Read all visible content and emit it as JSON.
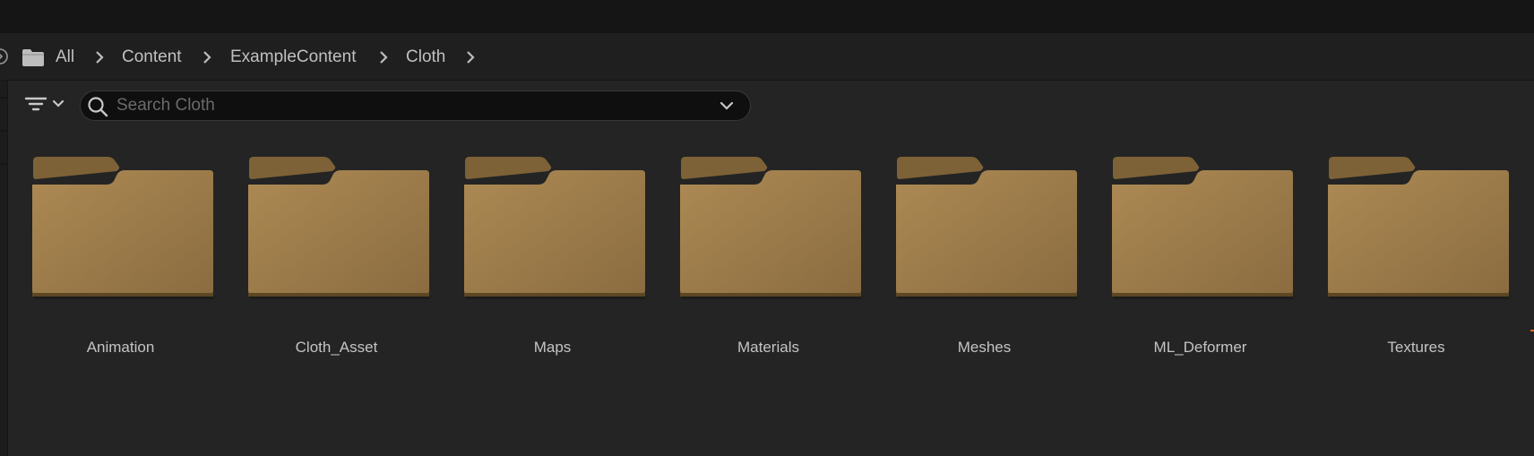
{
  "breadcrumb": {
    "items": [
      "All",
      "Content",
      "ExampleContent",
      "Cloth"
    ]
  },
  "search": {
    "placeholder": "Search Cloth",
    "value": ""
  },
  "folders": [
    "Animation",
    "Cloth_Asset",
    "Maps",
    "Materials",
    "Meshes",
    "ML_Deformer",
    "Textures"
  ],
  "colors": {
    "folder_back": "#7d6237",
    "folder_front": "#a5834f",
    "folder_front_dark": "#8a6c40",
    "background": "#242424",
    "accent_edge": "#e06a1a"
  },
  "icons": {
    "history": "history-icon",
    "root_folder": "folder-icon",
    "separator": "chevron-right-icon",
    "filter": "filter-icon",
    "search": "search-icon",
    "dropdown": "chevron-down-icon",
    "tile": "folder-icon"
  }
}
